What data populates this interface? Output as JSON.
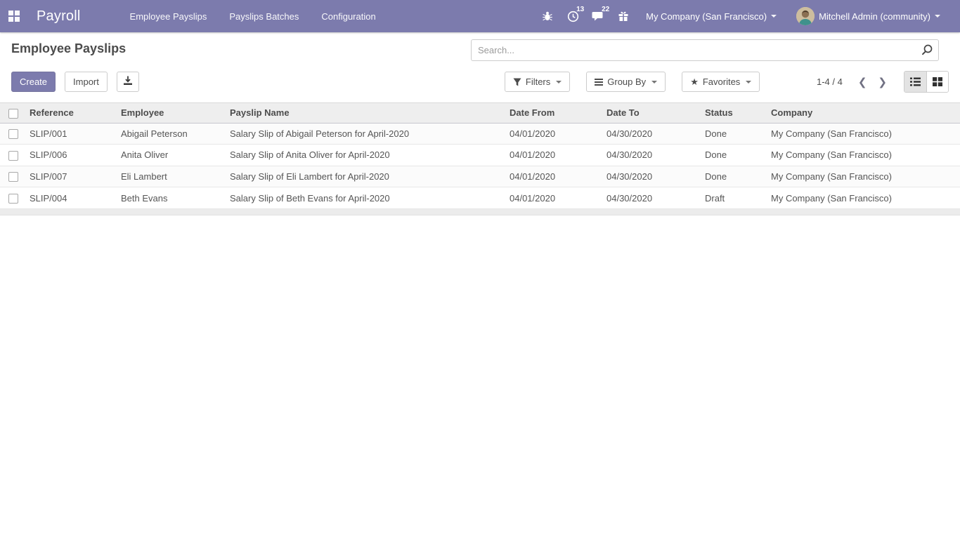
{
  "colors": {
    "navbar": "#7c7bad",
    "badge": "#00a09d",
    "accent": "#7c7bad"
  },
  "navbar": {
    "brand": "Payroll",
    "menus": [
      "Employee Payslips",
      "Payslips Batches",
      "Configuration"
    ],
    "activity_badge": "13",
    "messages_badge": "22",
    "company_menu": "My Company (San Francisco)",
    "user_menu": "Mitchell Admin (community)"
  },
  "control_panel": {
    "title": "Employee Payslips",
    "search_placeholder": "Search...",
    "create_label": "Create",
    "import_label": "Import",
    "filters_label": "Filters",
    "group_by_label": "Group By",
    "favorites_label": "Favorites",
    "favorites_star": "★",
    "pager_value": "1-4 / 4",
    "pager_prev": "❮",
    "pager_next": "❯"
  },
  "table": {
    "field_names": [
      "reference",
      "employee",
      "payslip-name",
      "date-from",
      "date-to",
      "status",
      "company"
    ],
    "headers": [
      "Reference",
      "Employee",
      "Payslip Name",
      "Date From",
      "Date To",
      "Status",
      "Company"
    ],
    "rows": [
      [
        "SLIP/001",
        "Abigail Peterson",
        "Salary Slip of Abigail Peterson for April-2020",
        "04/01/2020",
        "04/30/2020",
        "Done",
        "My Company (San Francisco)"
      ],
      [
        "SLIP/006",
        "Anita Oliver",
        "Salary Slip of Anita Oliver for April-2020",
        "04/01/2020",
        "04/30/2020",
        "Done",
        "My Company (San Francisco)"
      ],
      [
        "SLIP/007",
        "Eli Lambert",
        "Salary Slip of Eli Lambert for April-2020",
        "04/01/2020",
        "04/30/2020",
        "Done",
        "My Company (San Francisco)"
      ],
      [
        "SLIP/004",
        "Beth Evans",
        "Salary Slip of Beth Evans for April-2020",
        "04/01/2020",
        "04/30/2020",
        "Draft",
        "My Company (San Francisco)"
      ]
    ]
  }
}
